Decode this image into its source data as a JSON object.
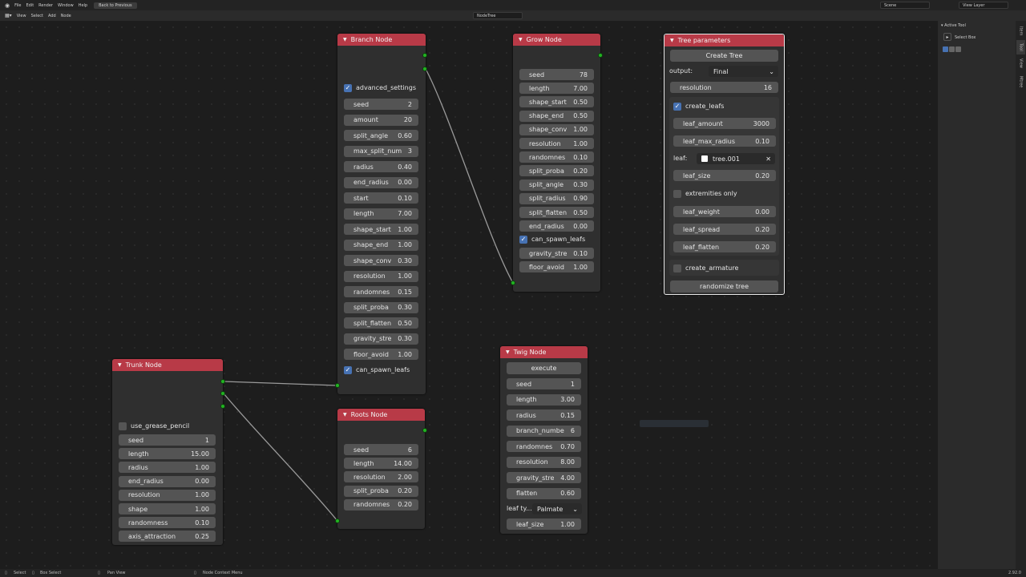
{
  "topbar": {
    "menus": [
      "File",
      "Edit",
      "Render",
      "Window",
      "Help"
    ],
    "back_button": "Back to Previous",
    "scene": "Scene",
    "view_layer": "View Layer"
  },
  "editor_header": {
    "menus": [
      "View",
      "Select",
      "Add",
      "Node"
    ],
    "node_tree_name": "NodeTree"
  },
  "nodes": {
    "branch": {
      "title": "Branch Node",
      "advanced_settings": "advanced_settings",
      "fields": [
        {
          "label": "seed",
          "value": "2"
        },
        {
          "label": "amount",
          "value": "20"
        },
        {
          "label": "split_angle",
          "value": "0.60"
        },
        {
          "label": "max_split_num",
          "value": "3"
        },
        {
          "label": "radius",
          "value": "0.40"
        },
        {
          "label": "end_radius",
          "value": "0.00"
        },
        {
          "label": "start",
          "value": "0.10"
        },
        {
          "label": "length",
          "value": "7.00"
        },
        {
          "label": "shape_start",
          "value": "1.00"
        },
        {
          "label": "shape_end",
          "value": "1.00"
        },
        {
          "label": "shape_conv",
          "value": "0.30"
        },
        {
          "label": "resolution",
          "value": "1.00"
        },
        {
          "label": "randomnes",
          "value": "0.15"
        },
        {
          "label": "split_proba",
          "value": "0.30"
        },
        {
          "label": "split_flatten",
          "value": "0.50"
        },
        {
          "label": "gravity_stre",
          "value": "0.30"
        },
        {
          "label": "floor_avoid",
          "value": "1.00"
        }
      ],
      "can_spawn_leafs": "can_spawn_leafs"
    },
    "grow": {
      "title": "Grow Node",
      "fields": [
        {
          "label": "seed",
          "value": "78"
        },
        {
          "label": "length",
          "value": "7.00"
        },
        {
          "label": "shape_start",
          "value": "0.50"
        },
        {
          "label": "shape_end",
          "value": "0.50"
        },
        {
          "label": "shape_conv",
          "value": "1.00"
        },
        {
          "label": "resolution",
          "value": "1.00"
        },
        {
          "label": "randomnes",
          "value": "0.10"
        },
        {
          "label": "split_proba",
          "value": "0.20"
        },
        {
          "label": "split_angle",
          "value": "0.30"
        },
        {
          "label": "split_radius",
          "value": "0.90"
        },
        {
          "label": "split_flatten",
          "value": "0.50"
        },
        {
          "label": "end_radius",
          "value": "0.00"
        }
      ],
      "can_spawn_leafs": "can_spawn_leafs",
      "fields2": [
        {
          "label": "gravity_stre",
          "value": "0.10"
        },
        {
          "label": "floor_avoid",
          "value": "1.00"
        }
      ]
    },
    "tree_params": {
      "title": "Tree parameters",
      "create_tree": "Create Tree",
      "output_label": "output:",
      "output_value": "Final",
      "resolution": {
        "label": "resolution",
        "value": "16"
      },
      "create_leafs": "create_leafs",
      "leaf_fields": [
        {
          "label": "leaf_amount",
          "value": "3000"
        },
        {
          "label": "leaf_max_radius",
          "value": "0.10"
        }
      ],
      "leaf_label": "leaf:",
      "leaf_object": "tree.001",
      "leaf_size": {
        "label": "leaf_size",
        "value": "0.20"
      },
      "extremities_only": "extremities only",
      "leaf_fields2": [
        {
          "label": "leaf_weight",
          "value": "0.00"
        },
        {
          "label": "leaf_spread",
          "value": "0.20"
        },
        {
          "label": "leaf_flatten",
          "value": "0.20"
        }
      ],
      "create_armature": "create_armature",
      "randomize": "randomize tree"
    },
    "trunk": {
      "title": "Trunk Node",
      "use_grease_pencil": "use_grease_pencil",
      "fields": [
        {
          "label": "seed",
          "value": "1"
        },
        {
          "label": "length",
          "value": "15.00"
        },
        {
          "label": "radius",
          "value": "1.00"
        },
        {
          "label": "end_radius",
          "value": "0.00"
        },
        {
          "label": "resolution",
          "value": "1.00"
        },
        {
          "label": "shape",
          "value": "1.00"
        },
        {
          "label": "randomness",
          "value": "0.10"
        },
        {
          "label": "axis_attraction",
          "value": "0.25"
        }
      ]
    },
    "roots": {
      "title": "Roots Node",
      "fields": [
        {
          "label": "seed",
          "value": "6"
        },
        {
          "label": "length",
          "value": "14.00"
        },
        {
          "label": "resolution",
          "value": "2.00"
        },
        {
          "label": "split_proba",
          "value": "0.20"
        },
        {
          "label": "randomnes",
          "value": "0.20"
        }
      ]
    },
    "twig": {
      "title": "Twig Node",
      "execute": "execute",
      "fields": [
        {
          "label": "seed",
          "value": "1"
        },
        {
          "label": "length",
          "value": "3.00"
        },
        {
          "label": "radius",
          "value": "0.15"
        },
        {
          "label": "branch_numbe",
          "value": "6"
        },
        {
          "label": "randomnes",
          "value": "0.70"
        },
        {
          "label": "resolution",
          "value": "8.00"
        },
        {
          "label": "gravity_stre",
          "value": "4.00"
        },
        {
          "label": "flatten",
          "value": "0.60"
        }
      ],
      "leaf_type_label": "leaf ty...",
      "leaf_type_value": "Palmate",
      "leaf_size": {
        "label": "leaf_size",
        "value": "1.00"
      }
    }
  },
  "sidebar": {
    "header": "Active Tool",
    "tool": "Select Box",
    "tabs": [
      "Item",
      "Tool",
      "View",
      "Mtree"
    ]
  },
  "status_bar": {
    "select": "Select",
    "box_select": "Box Select",
    "pan_view": "Pan View",
    "context_menu": "Node Context Menu",
    "version": "2.92.0"
  },
  "colors": {
    "node_header": "#b83a47",
    "socket": "#22b422",
    "checkbox_on": "#4772b3",
    "background": "#1d1d1d"
  }
}
